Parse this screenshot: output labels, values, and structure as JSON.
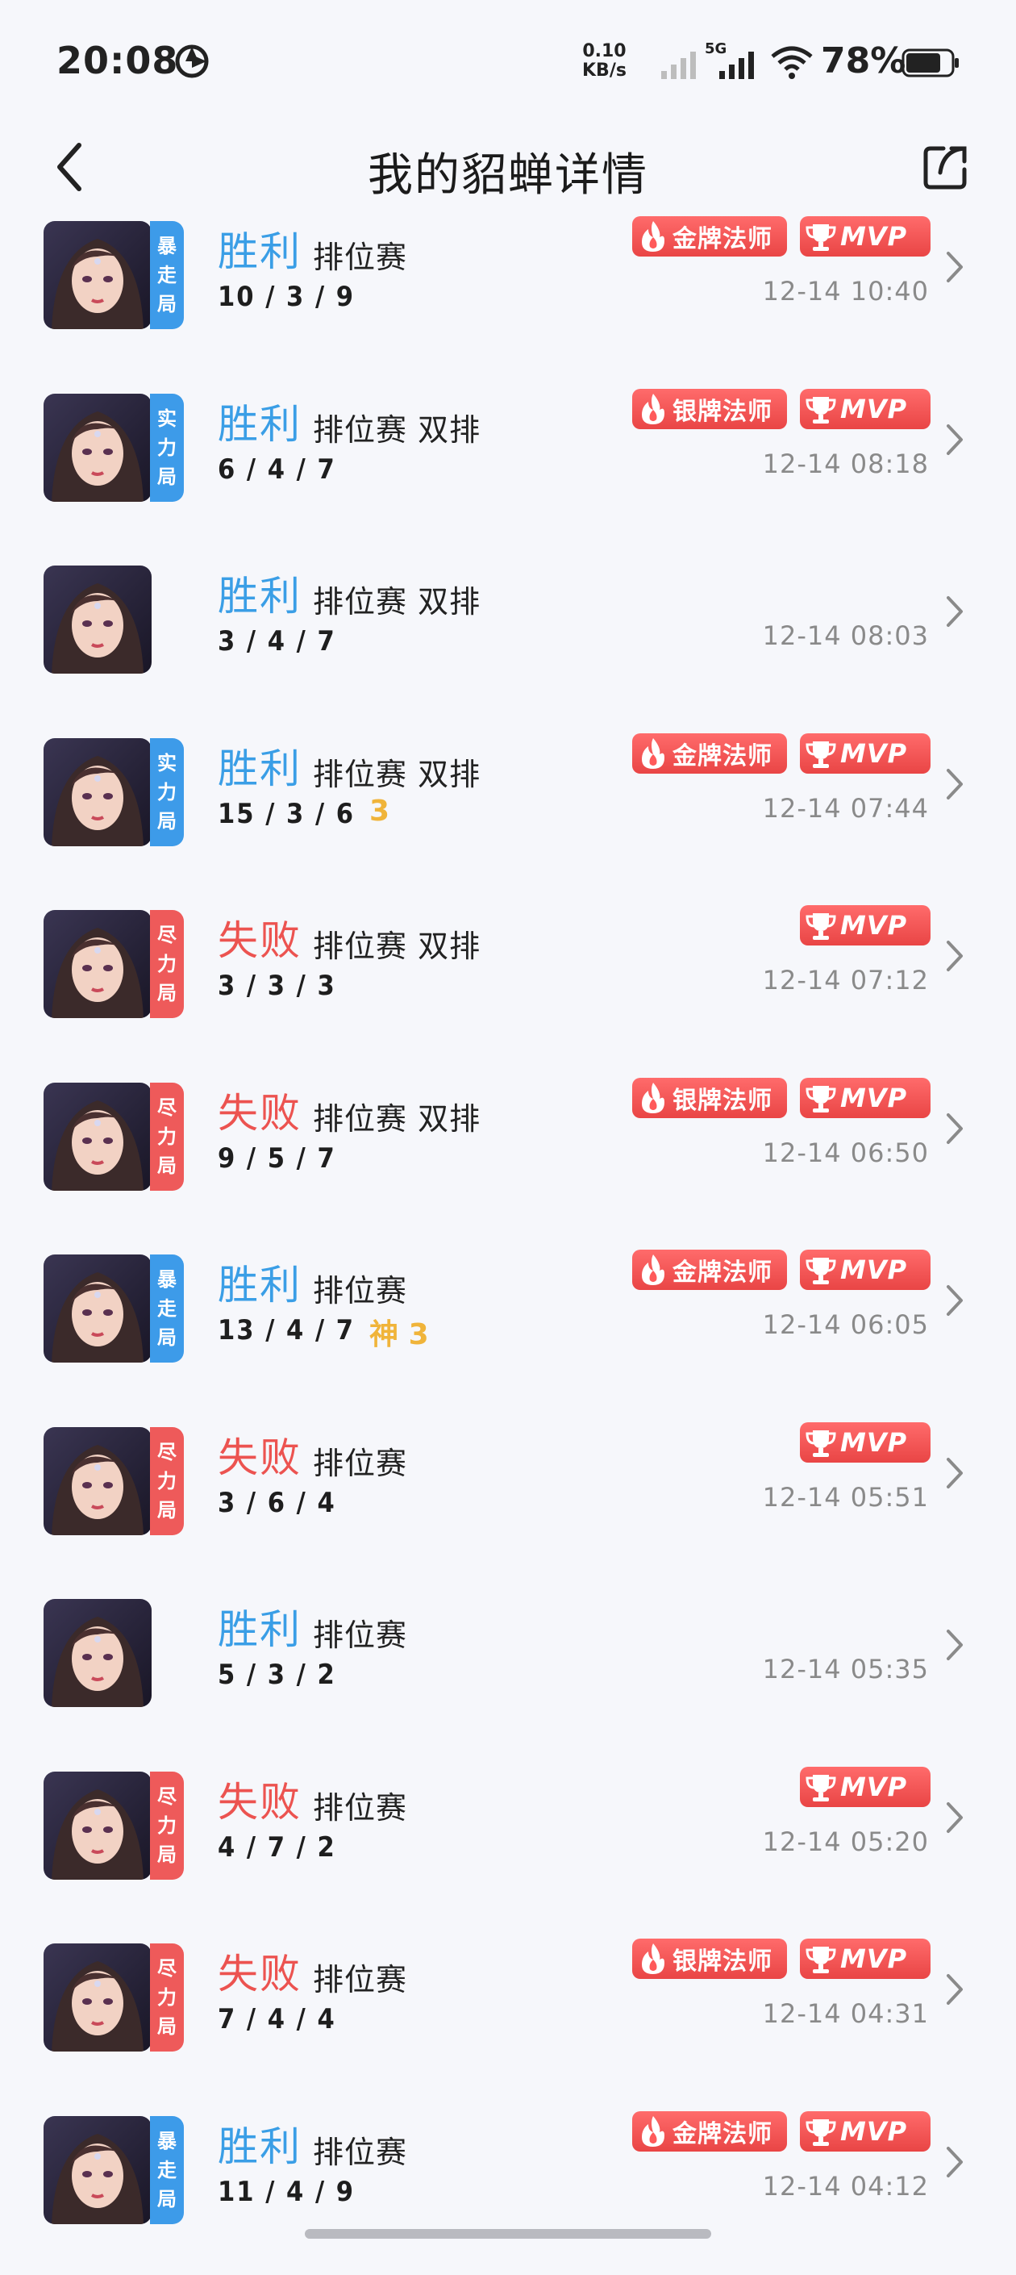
{
  "status_bar": {
    "time": "20:08",
    "net_speed_value": "0.10",
    "net_speed_unit": "KB/s",
    "network_type": "5G",
    "battery_percent": "78%",
    "battery_level": 0.78
  },
  "header": {
    "title": "我的貂蝉详情"
  },
  "matches": [
    {
      "result": "胜利",
      "result_type": "win",
      "mode": "排位赛",
      "kda": "10 / 3 / 9",
      "tag": [
        "暴",
        "走",
        "局"
      ],
      "tag_color": "blue",
      "rank_badge": "金牌法师",
      "mvp": "MVP",
      "time": "12-14 10:40",
      "streak": ""
    },
    {
      "result": "胜利",
      "result_type": "win",
      "mode": "排位赛 双排",
      "kda": "6 / 4 / 7",
      "tag": [
        "实",
        "力",
        "局"
      ],
      "tag_color": "blue",
      "rank_badge": "银牌法师",
      "mvp": "MVP",
      "time": "12-14 08:18",
      "streak": ""
    },
    {
      "result": "胜利",
      "result_type": "win",
      "mode": "排位赛 双排",
      "kda": "3 / 4 / 7",
      "tag": [],
      "tag_color": "",
      "rank_badge": "",
      "mvp": "",
      "time": "12-14 08:03",
      "streak": ""
    },
    {
      "result": "胜利",
      "result_type": "win",
      "mode": "排位赛 双排",
      "kda": "15 / 3 / 6",
      "tag": [
        "实",
        "力",
        "局"
      ],
      "tag_color": "blue",
      "rank_badge": "金牌法师",
      "mvp": "MVP",
      "time": "12-14 07:44",
      "streak": "3"
    },
    {
      "result": "失败",
      "result_type": "lose",
      "mode": "排位赛 双排",
      "kda": "3 / 3 / 3",
      "tag": [
        "尽",
        "力",
        "局"
      ],
      "tag_color": "red",
      "rank_badge": "",
      "mvp": "MVP",
      "time": "12-14 07:12",
      "streak": ""
    },
    {
      "result": "失败",
      "result_type": "lose",
      "mode": "排位赛 双排",
      "kda": "9 / 5 / 7",
      "tag": [
        "尽",
        "力",
        "局"
      ],
      "tag_color": "red",
      "rank_badge": "银牌法师",
      "mvp": "MVP",
      "time": "12-14 06:50",
      "streak": ""
    },
    {
      "result": "胜利",
      "result_type": "win",
      "mode": "排位赛",
      "kda": "13 / 4 / 7",
      "tag": [
        "暴",
        "走",
        "局"
      ],
      "tag_color": "blue",
      "rank_badge": "金牌法师",
      "mvp": "MVP",
      "time": "12-14 06:05",
      "streak": "神 3"
    },
    {
      "result": "失败",
      "result_type": "lose",
      "mode": "排位赛",
      "kda": "3 / 6 / 4",
      "tag": [
        "尽",
        "力",
        "局"
      ],
      "tag_color": "red",
      "rank_badge": "",
      "mvp": "MVP",
      "time": "12-14 05:51",
      "streak": ""
    },
    {
      "result": "胜利",
      "result_type": "win",
      "mode": "排位赛",
      "kda": "5 / 3 / 2",
      "tag": [],
      "tag_color": "",
      "rank_badge": "",
      "mvp": "",
      "time": "12-14 05:35",
      "streak": ""
    },
    {
      "result": "失败",
      "result_type": "lose",
      "mode": "排位赛",
      "kda": "4 / 7 / 2",
      "tag": [
        "尽",
        "力",
        "局"
      ],
      "tag_color": "red",
      "rank_badge": "",
      "mvp": "MVP",
      "time": "12-14 05:20",
      "streak": ""
    },
    {
      "result": "失败",
      "result_type": "lose",
      "mode": "排位赛",
      "kda": "7 / 4 / 4",
      "tag": [
        "尽",
        "力",
        "局"
      ],
      "tag_color": "red",
      "rank_badge": "银牌法师",
      "mvp": "MVP",
      "time": "12-14 04:31",
      "streak": ""
    },
    {
      "result": "胜利",
      "result_type": "win",
      "mode": "排位赛",
      "kda": "11 / 4 / 9",
      "tag": [
        "暴",
        "走",
        "局"
      ],
      "tag_color": "blue",
      "rank_badge": "金牌法师",
      "mvp": "MVP",
      "time": "12-14 04:12",
      "streak": ""
    }
  ],
  "icons": {
    "back": "back-arrow-icon",
    "share": "share-icon",
    "chevron": "chevron-right-icon",
    "rank_badge": "flame-icon",
    "mvp_badge": "trophy-icon"
  }
}
